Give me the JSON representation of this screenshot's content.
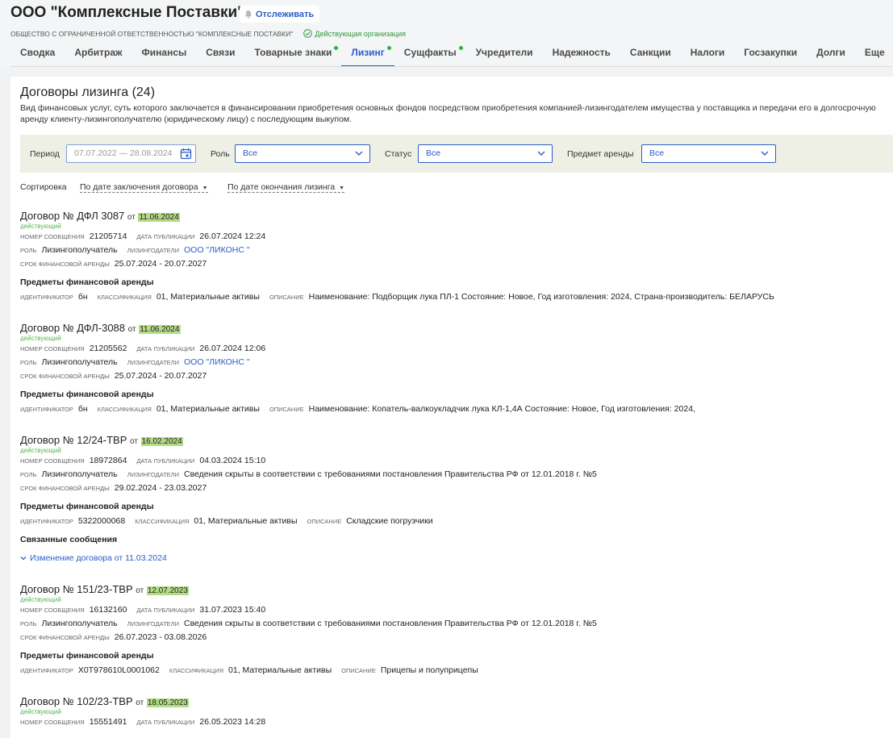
{
  "company": {
    "title": "ООО \"Комплексные Поставки\"",
    "watch_label": "Отслеживать",
    "full_name": "ОБЩЕСТВО С ОГРАНИЧЕННОЙ ОТВЕТСТВЕННОСТЬЮ \"КОМПЛЕКСНЫЕ ПОСТАВКИ\"",
    "status": "Действующая организация"
  },
  "tabs": [
    {
      "label": "Сводка"
    },
    {
      "label": "Арбитраж"
    },
    {
      "label": "Финансы"
    },
    {
      "label": "Связи"
    },
    {
      "label": "Товарные знаки",
      "dot": true
    },
    {
      "label": "Лизинг",
      "dot": true,
      "active": true
    },
    {
      "label": "Сущфакты",
      "dot": true
    },
    {
      "label": "Учредители"
    },
    {
      "label": "Надежность"
    },
    {
      "label": "Санкции"
    },
    {
      "label": "Налоги"
    },
    {
      "label": "Госзакупки"
    },
    {
      "label": "Долги"
    },
    {
      "label": "Еще"
    }
  ],
  "section": {
    "title": "Договоры лизинга (24)",
    "description": "Вид финансовых услуг, суть которого заключается в финансировании приобретения основных фондов посредством приобретения компанией-лизингодателем имущества у поставщика и передачи его в долгосрочную аренду клиенту-лизингополучателю (юридическому лицу) с последующим выкупом."
  },
  "filters": {
    "period_label": "Период",
    "period_value": "07.07.2022 — 28.08.2024",
    "role_label": "Роль",
    "role_value": "Все",
    "status_label": "Статус",
    "status_value": "Все",
    "subject_label": "Предмет аренды",
    "subject_value": "Все"
  },
  "sort": {
    "label": "Сортировка",
    "option1": "По дате заключения договора",
    "option2": "По дате окончания лизинга"
  },
  "labels": {
    "ot": "от",
    "msg_no": "номер сообщения",
    "pub_date": "дата публикации",
    "role": "роль",
    "lessors": "лизингодатели",
    "term": "срок финансовой аренды",
    "subjects": "Предметы финансовой аренды",
    "identifier": "идентификатор",
    "classification": "классификация",
    "description": "описание",
    "related": "Связанные сообщения"
  },
  "contracts": [
    {
      "title": "Договор № ДФЛ 3087",
      "date": "11.06.2024",
      "status": "действующий",
      "msg_no": "21205714",
      "pub_date": "26.07.2024 12:24",
      "role": "Лизингополучатель",
      "lessor": "ООО \"ЛИКОНС \"",
      "term": "25.07.2024 - 20.07.2027",
      "identifier": "бн",
      "classification": "01, Материальные активы",
      "description": "Наименование: Подборщик лука ПЛ-1 Состояние: Новое, Год изготовления: 2024, Страна-производитель: БЕЛАРУСЬ"
    },
    {
      "title": "Договор № ДФЛ-3088",
      "date": "11.06.2024",
      "status": "действующий",
      "msg_no": "21205562",
      "pub_date": "26.07.2024 12:06",
      "role": "Лизингополучатель",
      "lessor": "ООО \"ЛИКОНС \"",
      "term": "25.07.2024 - 20.07.2027",
      "identifier": "бн",
      "classification": "01, Материальные активы",
      "description": "Наименование: Копатель-валкоукладчик лука КЛ-1,4А Состояние: Новое, Год изготовления: 2024,"
    },
    {
      "title": "Договор № 12/24-ТВР",
      "date": "16.02.2024",
      "status": "действующий",
      "msg_no": "18972864",
      "pub_date": "04.03.2024 15:10",
      "role": "Лизингополучатель",
      "lessor": "Сведения скрыты в соответствии с требованиями постановления Правительства РФ от 12.01.2018 г. №5",
      "term": "29.02.2024 - 23.03.2027",
      "identifier": "5322000068",
      "classification": "01, Материальные активы",
      "description": "Складские погрузчики",
      "related_link": "Изменение договора от 11.03.2024"
    },
    {
      "title": "Договор № 151/23-ТВР",
      "date": "12.07.2023",
      "status": "действующий",
      "msg_no": "16132160",
      "pub_date": "31.07.2023 15:40",
      "role": "Лизингополучатель",
      "lessor": "Сведения скрыты в соответствии с требованиями постановления Правительства РФ от 12.01.2018 г. №5",
      "term": "26.07.2023 - 03.08.2026",
      "identifier": "X0T978610L0001062",
      "classification": "01, Материальные активы",
      "description": "Прицепы и полуприцепы"
    },
    {
      "title": "Договор № 102/23-ТВР",
      "date": "18.05.2023",
      "status": "действующий",
      "msg_no": "15551491",
      "pub_date": "26.05.2023 14:28"
    }
  ]
}
